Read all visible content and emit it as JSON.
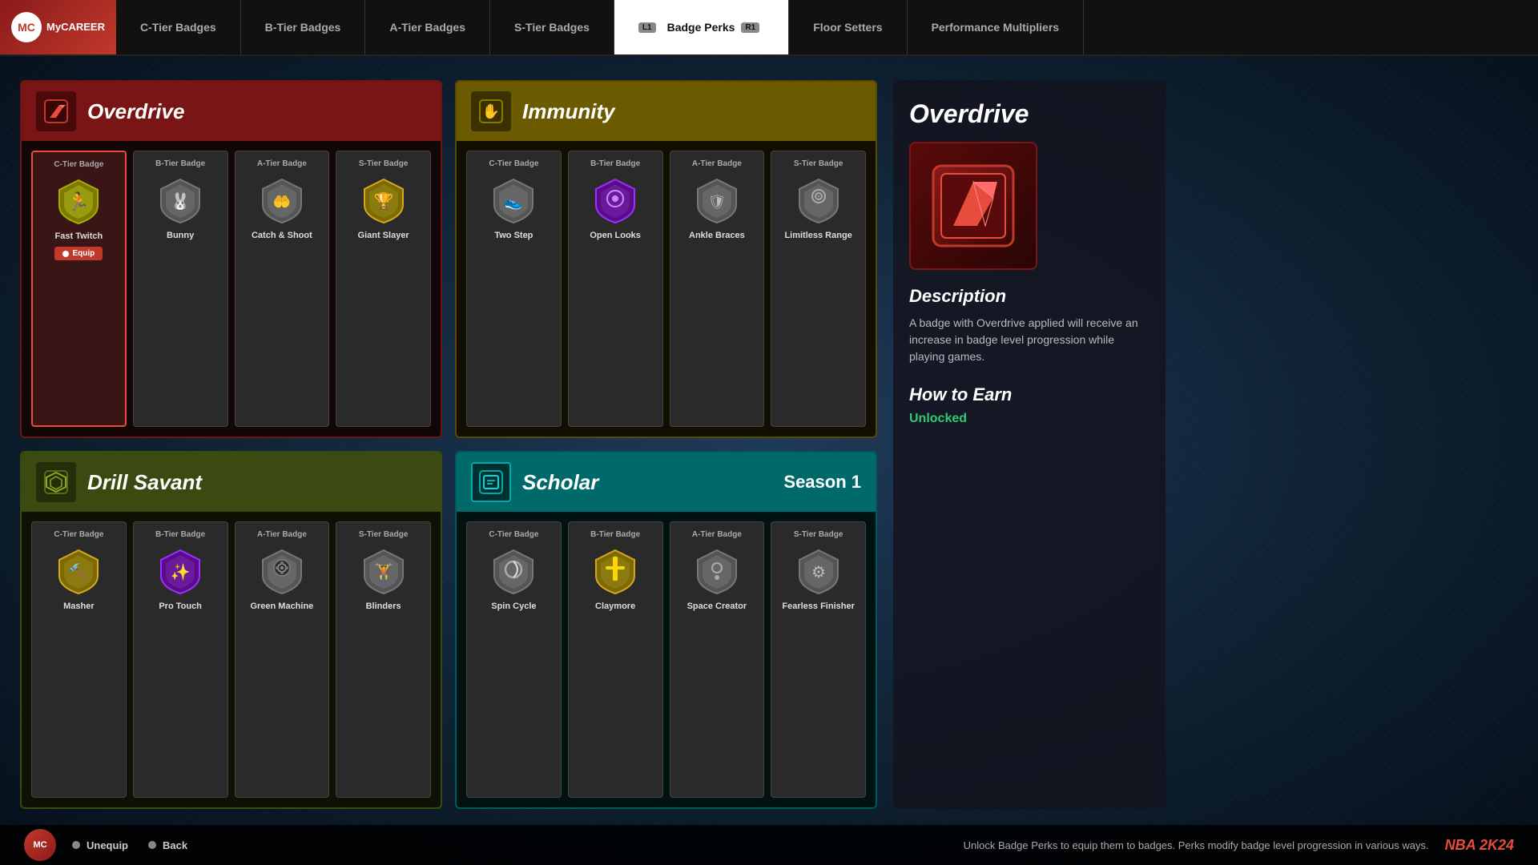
{
  "app": {
    "title": "MyCAREER",
    "logo_letters": "MC"
  },
  "nav": {
    "tabs": [
      {
        "id": "c-tier",
        "label": "C-Tier Badges",
        "active": false
      },
      {
        "id": "b-tier",
        "label": "B-Tier Badges",
        "active": false
      },
      {
        "id": "a-tier",
        "label": "A-Tier Badges",
        "active": false
      },
      {
        "id": "s-tier",
        "label": "S-Tier Badges",
        "active": false
      },
      {
        "id": "badge-perks",
        "label": "Badge Perks",
        "active": true,
        "key_left": "L1",
        "key_right": "R1"
      },
      {
        "id": "floor-setters",
        "label": "Floor Setters",
        "active": false
      },
      {
        "id": "performance",
        "label": "Performance Multipliers",
        "active": false
      }
    ]
  },
  "perks": {
    "overdrive": {
      "title": "Overdrive",
      "header_icon": "↗",
      "header_color": "#7a1515",
      "badges": [
        {
          "tier": "C-Tier Badge",
          "name": "Fast Twitch",
          "selected": true,
          "equip": true
        },
        {
          "tier": "B-Tier Badge",
          "name": "Bunny",
          "selected": false
        },
        {
          "tier": "A-Tier Badge",
          "name": "Catch & Shoot",
          "selected": false
        },
        {
          "tier": "S-Tier Badge",
          "name": "Giant Slayer",
          "selected": false
        }
      ]
    },
    "immunity": {
      "title": "Immunity",
      "header_icon": "✋",
      "header_color": "#6b5a00",
      "badges": [
        {
          "tier": "C-Tier Badge",
          "name": "Two Step",
          "selected": false
        },
        {
          "tier": "B-Tier Badge",
          "name": "Open Looks",
          "selected": false
        },
        {
          "tier": "A-Tier Badge",
          "name": "Ankle Braces",
          "selected": false
        },
        {
          "tier": "S-Tier Badge",
          "name": "Limitless Range",
          "selected": false
        }
      ]
    },
    "drill_savant": {
      "title": "Drill Savant",
      "header_icon": "◈",
      "header_color": "#3a4a10",
      "badges": [
        {
          "tier": "C-Tier Badge",
          "name": "Masher",
          "selected": false
        },
        {
          "tier": "B-Tier Badge",
          "name": "Pro Touch",
          "selected": false
        },
        {
          "tier": "A-Tier Badge",
          "name": "Green Machine",
          "selected": false
        },
        {
          "tier": "S-Tier Badge",
          "name": "Blinders",
          "selected": false
        }
      ]
    },
    "scholar": {
      "title": "Scholar",
      "season": "Season 1",
      "header_icon": "🏠",
      "header_color": "#006a6a",
      "badges": [
        {
          "tier": "C-Tier Badge",
          "name": "Spin Cycle",
          "selected": false
        },
        {
          "tier": "B-Tier Badge",
          "name": "Claymore",
          "selected": false
        },
        {
          "tier": "A-Tier Badge",
          "name": "Space Creator",
          "selected": false
        },
        {
          "tier": "S-Tier Badge",
          "name": "Fearless Finisher",
          "selected": false
        }
      ]
    }
  },
  "detail": {
    "title": "Overdrive",
    "description_label": "Description",
    "description": "A badge with Overdrive applied will receive an increase in badge level progression while playing games.",
    "how_to_earn_label": "How to Earn",
    "status": "Unlocked"
  },
  "bottom": {
    "unequip_label": "Unequip",
    "back_label": "Back",
    "hint": "Unlock Badge Perks to equip them to badges. Perks modify badge level progression in various ways.",
    "nba2k_logo": "NBA 2K24"
  }
}
